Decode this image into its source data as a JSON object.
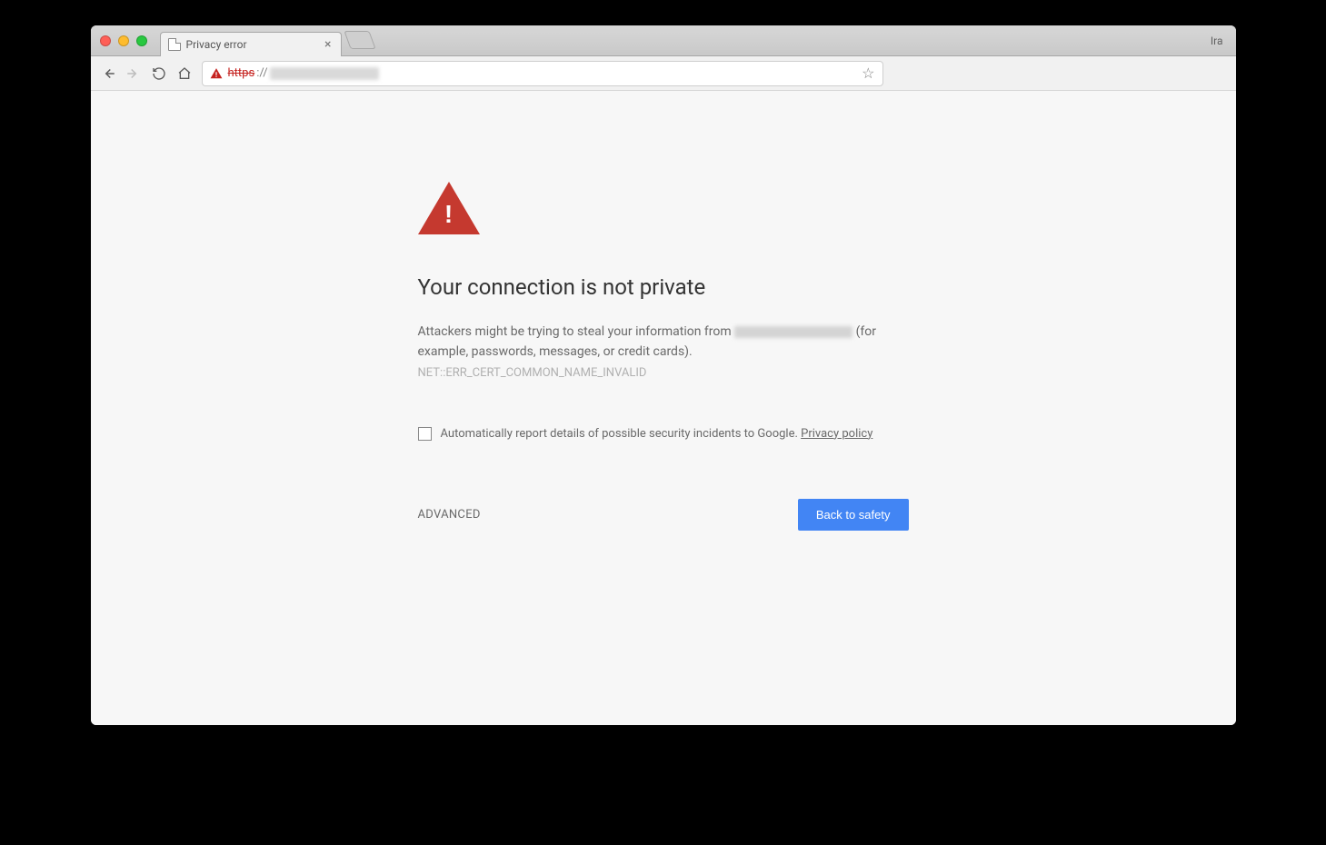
{
  "window": {
    "profile_name": "Ira"
  },
  "tab": {
    "title": "Privacy error"
  },
  "omnibox": {
    "scheme": "https",
    "separator": "://"
  },
  "error": {
    "heading": "Your connection is not private",
    "body_pre": "Attackers might be trying to steal your information from ",
    "body_post": " (for example, passwords, messages, or credit cards). ",
    "code": "NET::ERR_CERT_COMMON_NAME_INVALID",
    "report_label": "Automatically report details of possible security incidents to Google. ",
    "privacy_policy": "Privacy policy",
    "advanced_label": "ADVANCED",
    "back_label": "Back to safety"
  }
}
